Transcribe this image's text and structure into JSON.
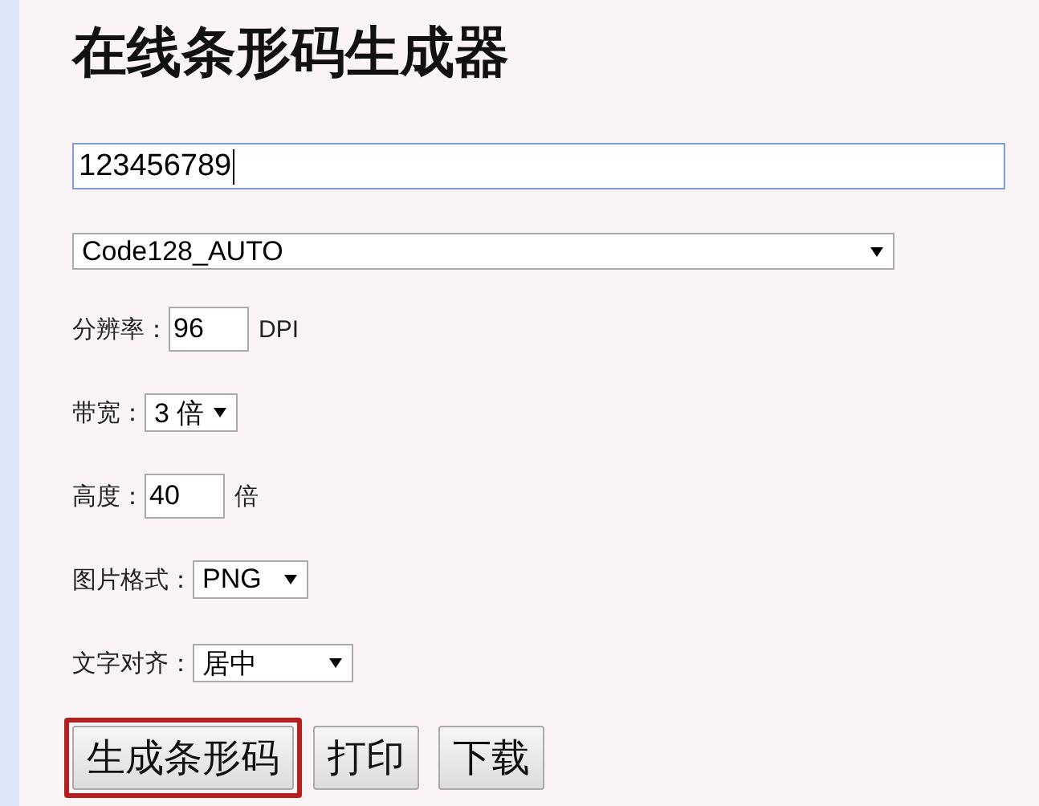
{
  "title": "在线条形码生成器",
  "code_input": {
    "value": "123456789",
    "focused": true
  },
  "symbology": {
    "value": "Code128_AUTO"
  },
  "options": [
    {
      "kind": "input",
      "label": "分辨率：",
      "value": "96",
      "unit": "DPI"
    },
    {
      "kind": "select",
      "label": "带宽：",
      "value": "3 倍"
    },
    {
      "kind": "input",
      "label": "高度：",
      "value": "40",
      "unit": "倍"
    },
    {
      "kind": "select",
      "label": "图片格式：",
      "value": "PNG"
    },
    {
      "kind": "select",
      "label": "文字对齐：",
      "value": "居中"
    }
  ],
  "buttons": [
    {
      "label": "生成条形码",
      "highlighted": true
    },
    {
      "label": "打印",
      "highlighted": false
    },
    {
      "label": "下载",
      "highlighted": false
    }
  ]
}
